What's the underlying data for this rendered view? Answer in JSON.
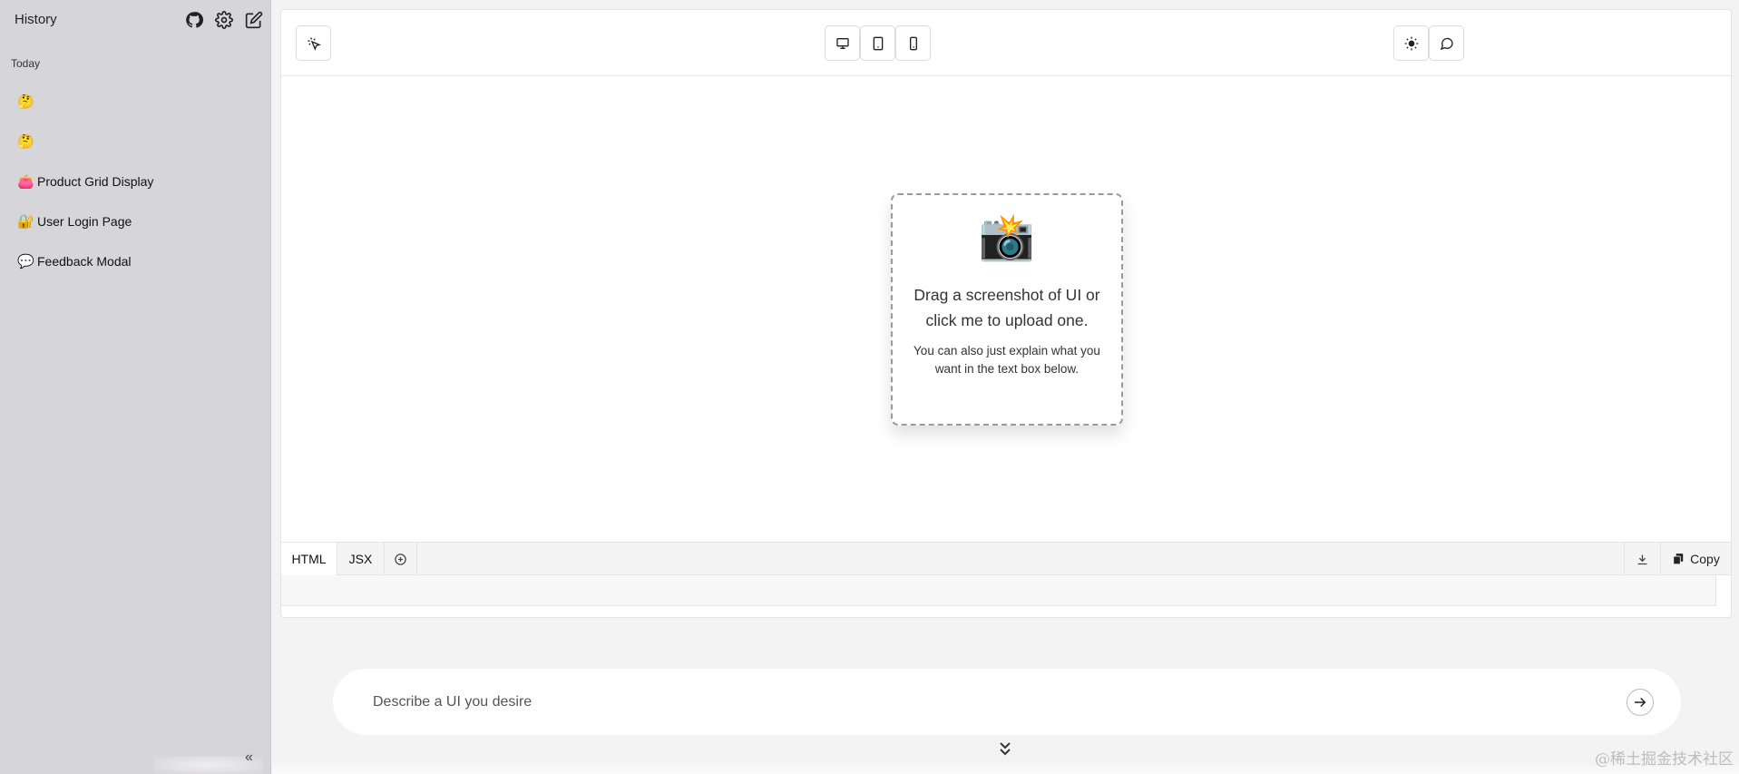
{
  "sidebar": {
    "title": "History",
    "section_label": "Today",
    "items": [
      {
        "emoji": "🤔",
        "label": ""
      },
      {
        "emoji": "🤔",
        "label": ""
      },
      {
        "emoji": "👛",
        "label": "Product Grid Display"
      },
      {
        "emoji": "🔐",
        "label": "User Login Page"
      },
      {
        "emoji": "💬",
        "label": "Feedback Modal"
      }
    ],
    "icons": [
      "github-icon",
      "gear-icon",
      "edit-icon"
    ],
    "collapse_glyph": "«"
  },
  "toolbar": {
    "select_tool": "cursor-click-icon",
    "devices": [
      "desktop-icon",
      "tablet-icon",
      "mobile-icon"
    ],
    "right": [
      "sun-icon",
      "chat-icon"
    ]
  },
  "dropzone": {
    "icon": "📸",
    "title": "Drag a screenshot of UI or click me to upload one.",
    "subtitle": "You can also just explain what you want in the text box below."
  },
  "code_tabs": {
    "tabs": [
      "HTML",
      "JSX"
    ],
    "active": "HTML",
    "copy_label": "Copy"
  },
  "prompt": {
    "placeholder": "Describe a UI you desire"
  },
  "watermark": "@稀土掘金技术社区"
}
